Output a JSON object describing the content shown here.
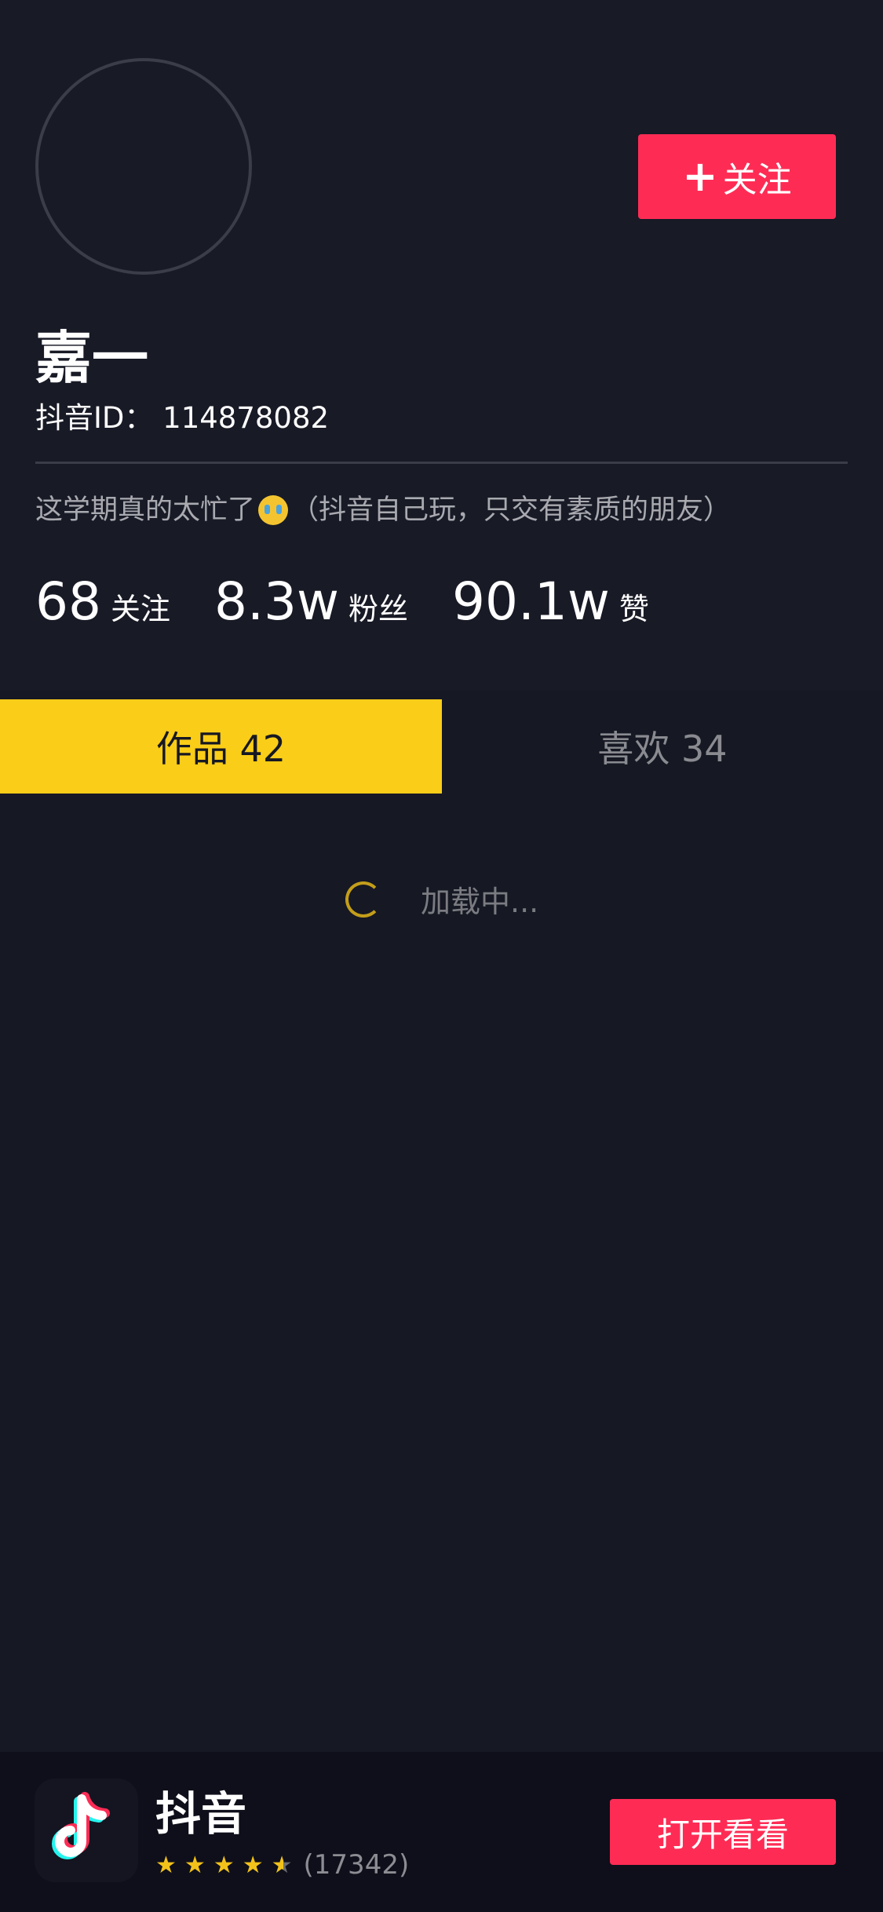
{
  "profile": {
    "follow_label": "关注",
    "nickname": "嘉一",
    "douyin_id": "抖音ID：  114878082",
    "bio_before": "这学期真的太忙了",
    "bio_after": "（抖音自己玩，只交有素质的朋友）"
  },
  "stats": [
    {
      "value": "68",
      "label": "关注"
    },
    {
      "value": "8.3w",
      "label": "粉丝"
    },
    {
      "value": "90.1w",
      "label": "赞"
    }
  ],
  "tabs": [
    {
      "label": "作品 42",
      "active": true
    },
    {
      "label": "喜欢 34",
      "active": false
    }
  ],
  "loading": {
    "text": "加载中..."
  },
  "banner": {
    "app_name": "抖音",
    "rating": 4.5,
    "rating_count": "(17342)",
    "open_label": "打开看看"
  },
  "colors": {
    "background": "#161823",
    "accent_red": "#fe2c55",
    "tab_active": "#facd18",
    "star": "#f2c21b"
  },
  "icons": {
    "follow": "plus-icon",
    "emoji": "crying-face-emoji",
    "loading": "spinner-icon",
    "app": "douyin-logo-icon"
  }
}
